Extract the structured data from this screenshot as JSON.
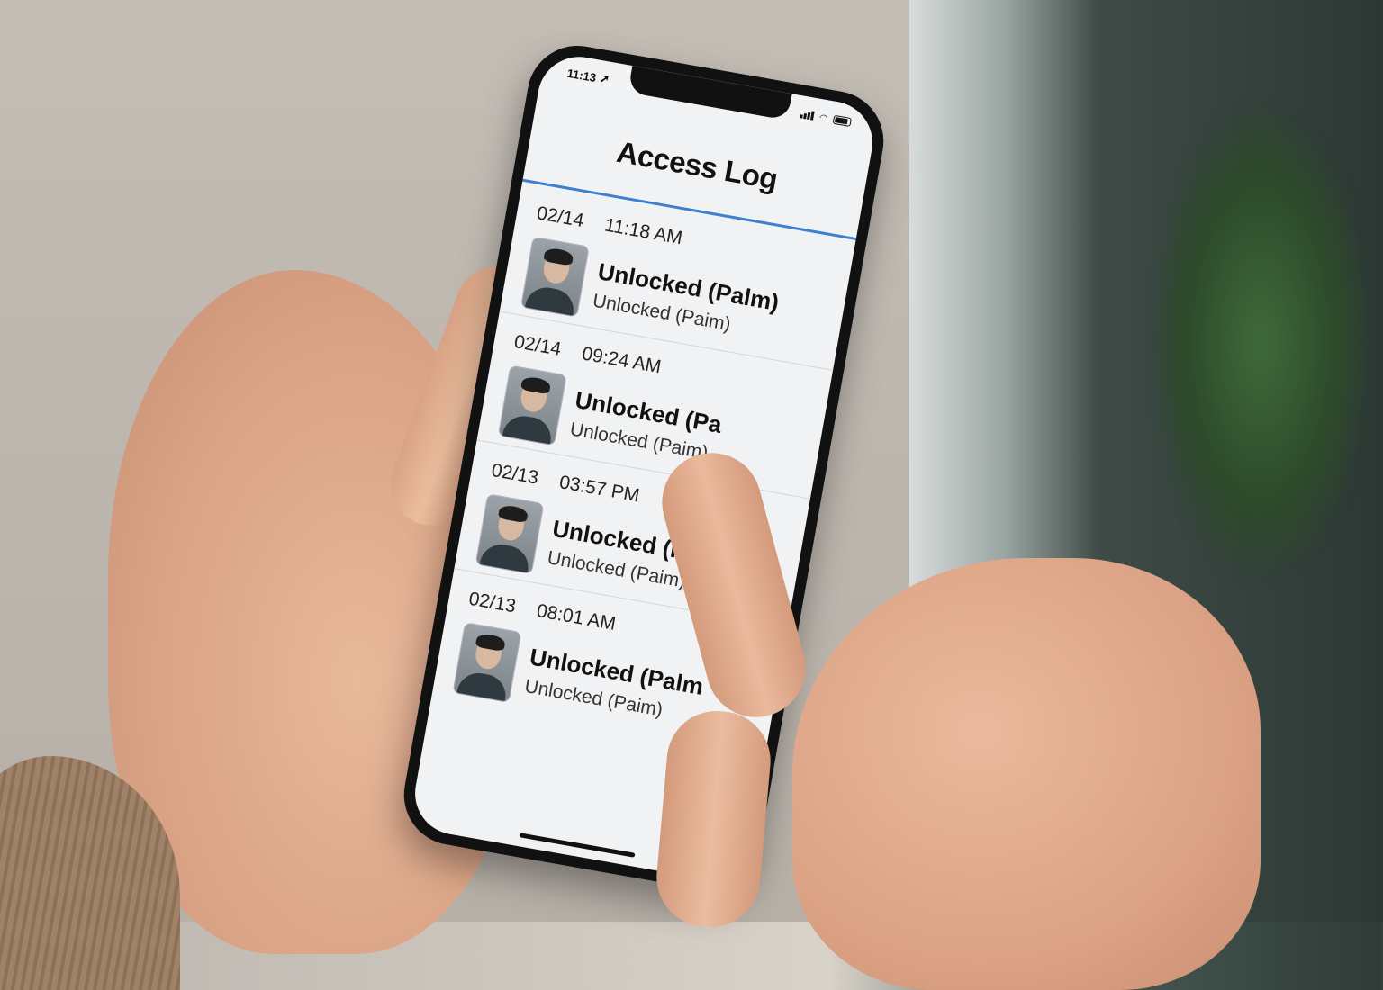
{
  "status_bar": {
    "time": "11:13"
  },
  "app": {
    "title": "Access Log"
  },
  "entries": [
    {
      "date": "02/14",
      "time": "11:18 AM",
      "status": "Unlocked (Palm)",
      "detail": "Unlocked (Paim)"
    },
    {
      "date": "02/14",
      "time": "09:24 AM",
      "status": "Unlocked (Pa",
      "detail": "Unlocked (Paim)"
    },
    {
      "date": "02/13",
      "time": "03:57 PM",
      "status": "Unlocked (Palm)",
      "detail": "Unlocked (Paim)"
    },
    {
      "date": "02/13",
      "time": "08:01 AM",
      "status": "Unlocked (Palm",
      "detail": "Unlocked (Paim)"
    }
  ],
  "colors": {
    "accent": "#3d7fd1",
    "screen_bg": "#f1f2f4"
  }
}
